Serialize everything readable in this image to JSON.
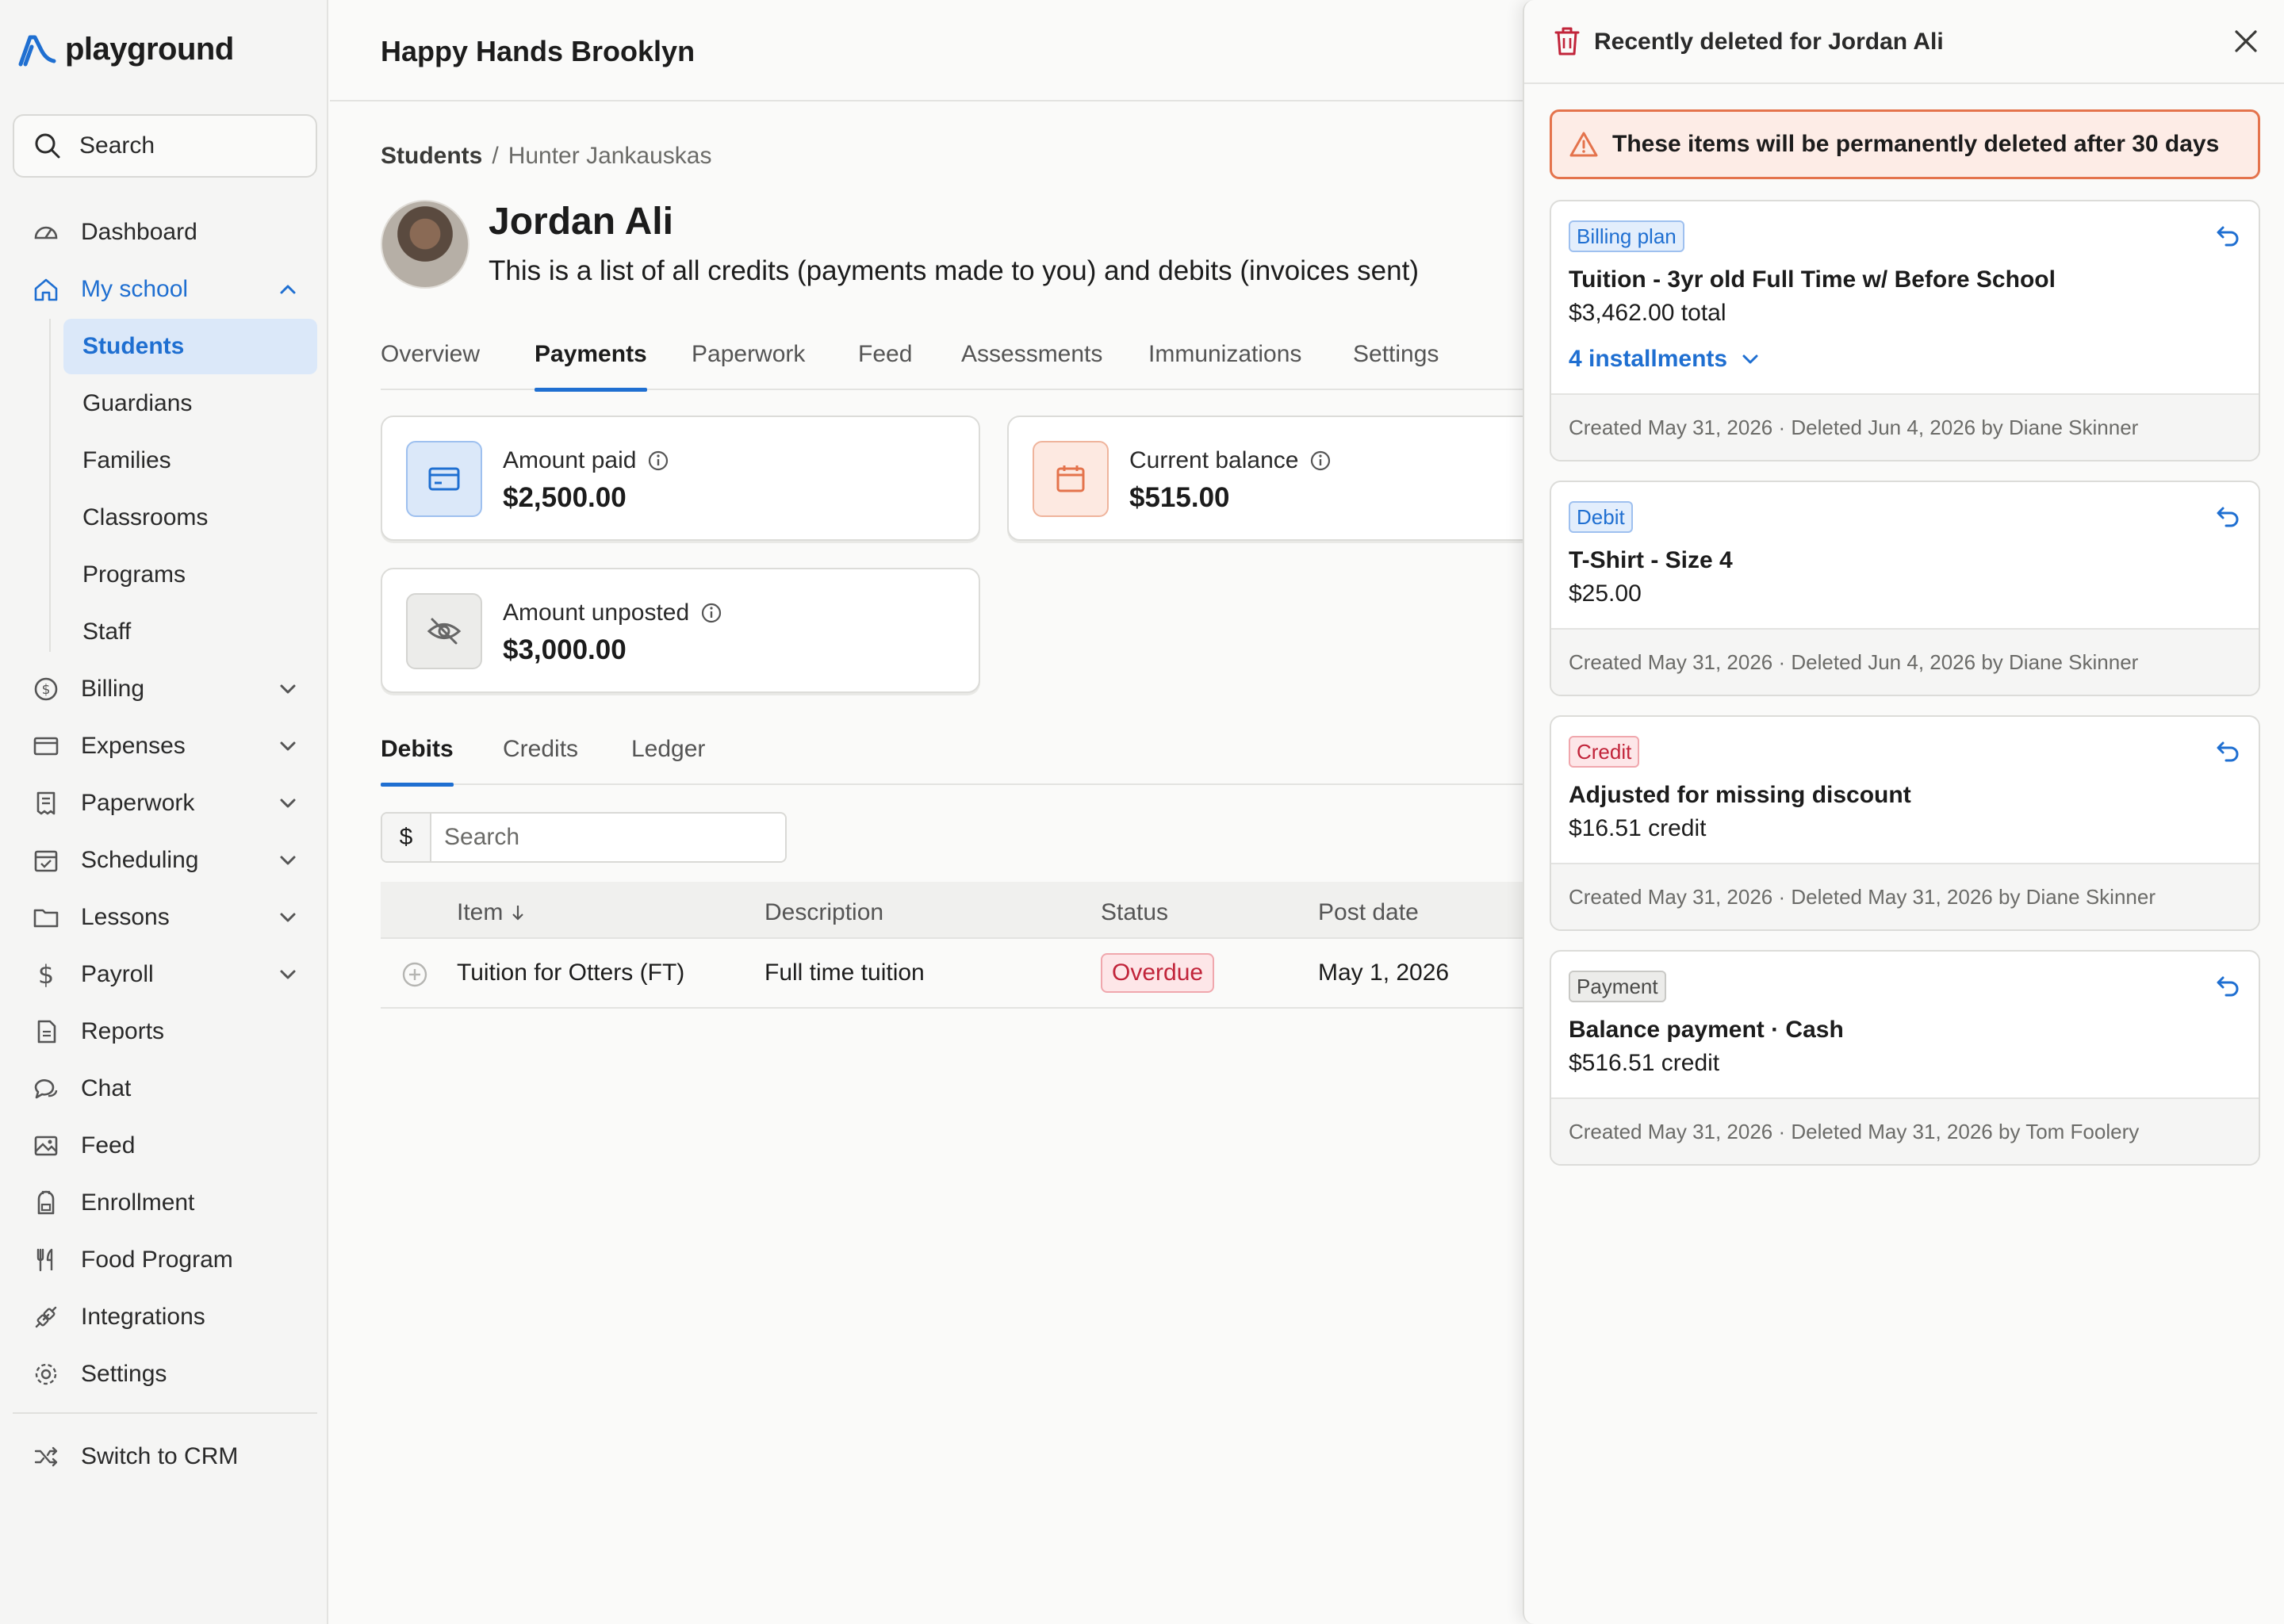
{
  "app": {
    "brand": "playground"
  },
  "sidebar": {
    "search_label": "Search",
    "items": [
      {
        "label": "Dashboard",
        "icon": "gauge-icon"
      },
      {
        "label": "My school",
        "icon": "home-icon",
        "expanded": true
      },
      {
        "label": "Billing",
        "icon": "dollar-circle-icon"
      },
      {
        "label": "Expenses",
        "icon": "card-icon"
      },
      {
        "label": "Paperwork",
        "icon": "receipt-icon"
      },
      {
        "label": "Scheduling",
        "icon": "calendar-check-icon"
      },
      {
        "label": "Lessons",
        "icon": "folder-icon"
      },
      {
        "label": "Payroll",
        "icon": "dollar-icon"
      },
      {
        "label": "Reports",
        "icon": "report-icon"
      },
      {
        "label": "Chat",
        "icon": "chat-icon"
      },
      {
        "label": "Feed",
        "icon": "image-icon"
      },
      {
        "label": "Enrollment",
        "icon": "backpack-icon"
      },
      {
        "label": "Food Program",
        "icon": "utensils-icon"
      },
      {
        "label": "Integrations",
        "icon": "plug-icon"
      },
      {
        "label": "Settings",
        "icon": "gear-icon"
      }
    ],
    "school_sub": [
      "Students",
      "Guardians",
      "Families",
      "Classrooms",
      "Programs",
      "Staff"
    ],
    "switch_label": "Switch to CRM"
  },
  "header": {
    "school": "Happy Hands Brooklyn"
  },
  "breadcrumb": {
    "root": "Students",
    "sep": "/",
    "current": "Hunter Jankauskas"
  },
  "student": {
    "name": "Jordan Ali",
    "description": "This is a list of all credits (payments made to you) and debits (invoices sent)"
  },
  "tabs": [
    "Overview",
    "Payments",
    "Paperwork",
    "Feed",
    "Assessments",
    "Immunizations",
    "Settings"
  ],
  "cards": {
    "paid": {
      "label": "Amount paid",
      "value": "$2,500.00"
    },
    "balance": {
      "label": "Current balance",
      "value": "$515.00"
    },
    "unposted": {
      "label": "Amount unposted",
      "value": "$3,000.00"
    }
  },
  "subtabs": [
    "Debits",
    "Credits",
    "Ledger"
  ],
  "table": {
    "search_prefix": "$",
    "search_placeholder": "Search",
    "headers": [
      "Item",
      "Description",
      "Status",
      "Post date"
    ],
    "rows": [
      {
        "item": "Tuition for Otters (FT)",
        "description": "Full time tuition",
        "status": "Overdue",
        "post_date": "May 1, 2026"
      }
    ]
  },
  "drawer": {
    "title": "Recently deleted for Jordan Ali",
    "warning": "These items will be permanently deleted after 30 days",
    "items": [
      {
        "tag": "Billing plan",
        "title": "Tuition - 3yr old Full Time w/ Before School",
        "amount": "$3,462.00 total",
        "installments": "4 installments",
        "meta": "Created May 31, 2026 · Deleted Jun 4, 2026 by Diane Skinner"
      },
      {
        "tag": "Debit",
        "title": "T-Shirt - Size 4",
        "amount": "$25.00",
        "meta": "Created May 31, 2026 · Deleted Jun 4, 2026 by Diane Skinner"
      },
      {
        "tag": "Credit",
        "title": "Adjusted for missing discount",
        "amount": "$16.51 credit",
        "meta": "Created May 31, 2026 · Deleted May 31, 2026 by Diane Skinner"
      },
      {
        "tag": "Payment",
        "title": "Balance payment · Cash",
        "amount": "$516.51 credit",
        "meta": "Created May 31, 2026 · Deleted May 31, 2026 by Tom Foolery"
      }
    ]
  },
  "colors": {
    "accent": "#1f6fd1",
    "danger": "#c1243a",
    "warning_border": "#e4734c"
  }
}
